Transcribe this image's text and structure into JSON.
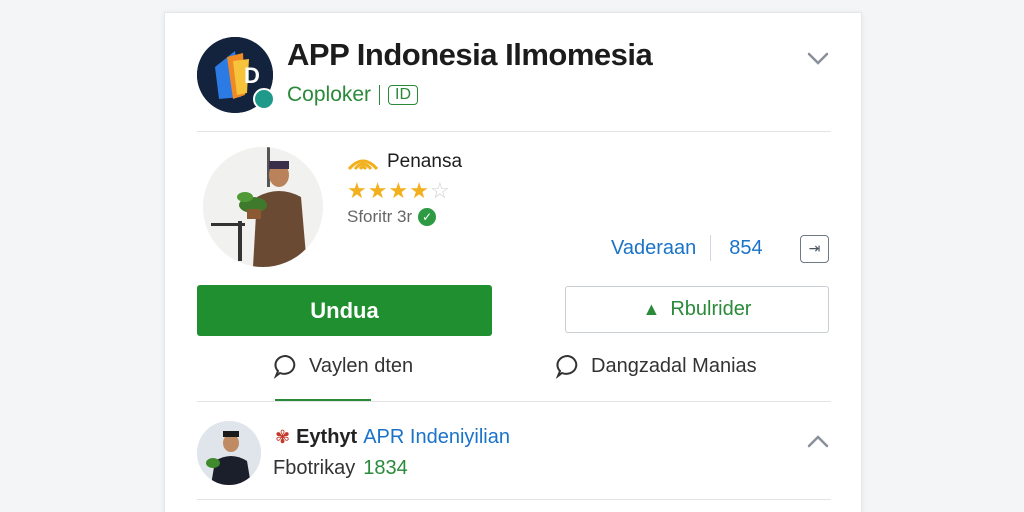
{
  "header": {
    "title": "APP Indonesia Ilmomesia",
    "developer": "Coploker",
    "developer_tag": "ID"
  },
  "profile": {
    "rating_label": "Penansa",
    "rating_stars": 4,
    "rating_max": 5,
    "verified_label": "Sforitr 3r"
  },
  "stats": {
    "link_label": "Vaderaan",
    "count": "854"
  },
  "actions": {
    "primary_label": "Undua",
    "secondary_label": "Rbulrider"
  },
  "tabs": [
    {
      "label": "Vaylen dten"
    },
    {
      "label": "Dangzadal Manias"
    }
  ],
  "bottom_item": {
    "name": "Eythyt",
    "title": "APR Indeniyilian",
    "subtitle": "Fbotrikay",
    "count": "1834"
  },
  "colors": {
    "accent_green": "#1f8f2f",
    "link_blue": "#1a73c8",
    "star_gold": "#f2b01e"
  }
}
